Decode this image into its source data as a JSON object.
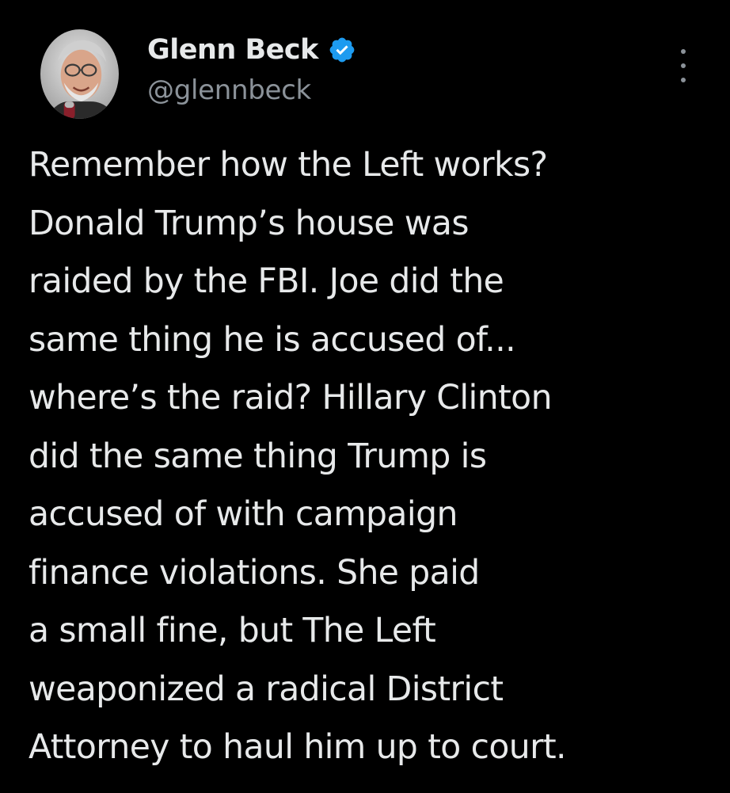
{
  "author": {
    "display_name": "Glenn Beck",
    "handle": "@glennbeck",
    "verified": true
  },
  "tweet": {
    "text": "Remember how the Left works?\nDonald Trump’s house was\nraided by the FBI. Joe did the\nsame thing he is accused of...\nwhere’s the raid? Hillary Clinton\ndid the same thing Trump is\naccused of with campaign\nfinance violations. She paid\na small fine, but The Left\nweaponized a radical District\nAttorney to haul him up to court."
  },
  "icons": {
    "verified": "verified-badge-icon",
    "more": "more-options-icon"
  },
  "colors": {
    "background": "#000000",
    "text_primary": "#e7e9ea",
    "text_secondary": "#8b9299",
    "verified_blue": "#1d9bf0"
  }
}
